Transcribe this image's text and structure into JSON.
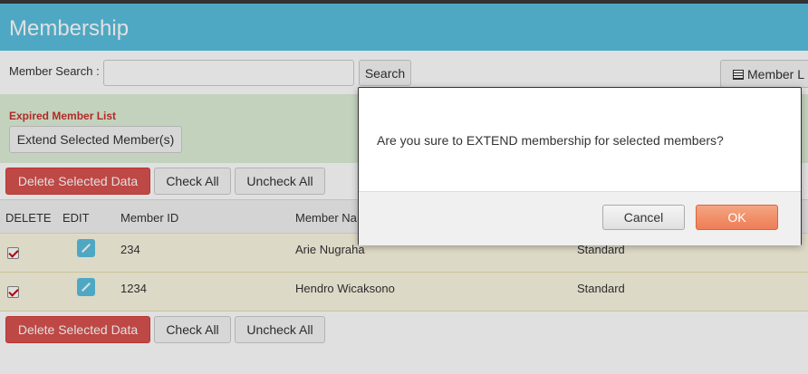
{
  "header": {
    "title": "Membership"
  },
  "search": {
    "label": "Member Search :",
    "input_value": "",
    "button_label": "Search"
  },
  "member_list_button": {
    "label": "Member L"
  },
  "expired_panel": {
    "title": "Expired Member List",
    "extend_button": "Extend Selected Member(s)"
  },
  "actions": {
    "delete_label": "Delete Selected Data",
    "check_all_label": "Check All",
    "uncheck_all_label": "Uncheck All"
  },
  "table": {
    "columns": [
      "DELETE",
      "EDIT",
      "Member ID",
      "Member Na"
    ],
    "rows": [
      {
        "checked": true,
        "member_id": "234",
        "member_name": "Arie Nugraha",
        "type": "Standard"
      },
      {
        "checked": true,
        "member_id": "1234",
        "member_name": "Hendro Wicaksono",
        "type": "Standard"
      }
    ]
  },
  "modal": {
    "message": "Are you sure to EXTEND membership for selected members?",
    "cancel_label": "Cancel",
    "ok_label": "OK"
  },
  "colors": {
    "header": "#5bc0de",
    "danger": "#d9534f",
    "expired_title": "#c9302c",
    "row_bg": "#fcf8e3",
    "ok_button": "#ee7d55"
  }
}
